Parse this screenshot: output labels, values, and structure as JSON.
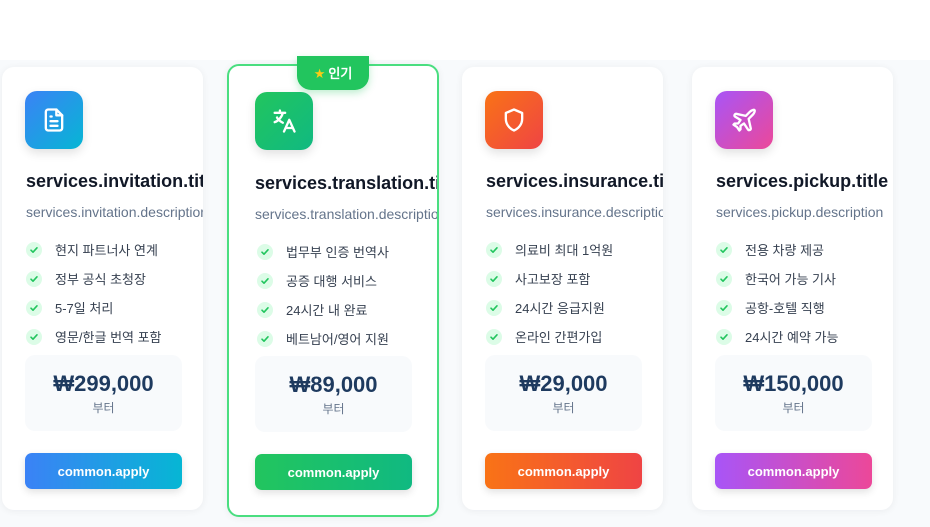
{
  "cards": [
    {
      "title": "services.invitation.title",
      "description": "services.invitation.description",
      "icon": "document-icon",
      "features": [
        "현지 파트너사 연계",
        "정부 공식 초청장",
        "5-7일 처리",
        "영문/한글 번역 포함"
      ],
      "price": "₩299,000",
      "price_suffix": "부터",
      "button": "common.apply",
      "colors": [
        "#3b82f6",
        "#06b6d4"
      ]
    },
    {
      "title": "services.translation.title",
      "description": "services.translation.description",
      "icon": "translate-icon",
      "badge": "인기",
      "features": [
        "법무부 인증 번역사",
        "공증 대행 서비스",
        "24시간 내 완료",
        "베트남어/영어 지원"
      ],
      "price": "₩89,000",
      "price_suffix": "부터",
      "button": "common.apply",
      "colors": [
        "#22c55e",
        "#10b981"
      ]
    },
    {
      "title": "services.insurance.title",
      "description": "services.insurance.description",
      "icon": "shield-icon",
      "features": [
        "의료비 최대 1억원",
        "사고보장 포함",
        "24시간 응급지원",
        "온라인 간편가입"
      ],
      "price": "₩29,000",
      "price_suffix": "부터",
      "button": "common.apply",
      "colors": [
        "#f97316",
        "#ef4444"
      ]
    },
    {
      "title": "services.pickup.title",
      "description": "services.pickup.description",
      "icon": "airplane-icon",
      "features": [
        "전용 차량 제공",
        "한국어 가능 기사",
        "공항-호텔 직행",
        "24시간 예약 가능"
      ],
      "price": "₩150,000",
      "price_suffix": "부터",
      "button": "common.apply",
      "colors": [
        "#a855f7",
        "#ec4899"
      ]
    }
  ]
}
